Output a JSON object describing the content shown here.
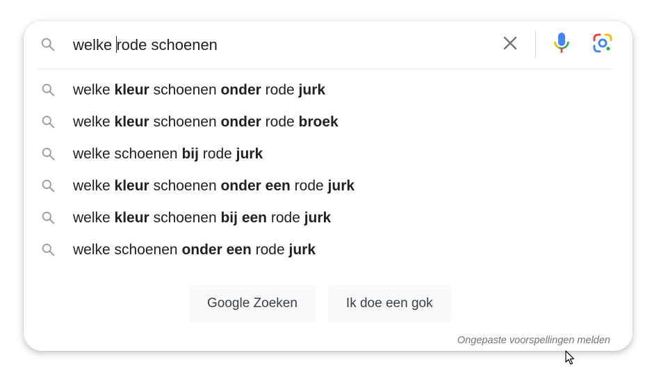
{
  "search": {
    "query_before_caret": "welke ",
    "query_after_caret": "rode schoenen"
  },
  "icons": {
    "search": "search-icon",
    "clear": "close-icon",
    "voice": "microphone-icon",
    "lens": "google-lens-icon",
    "cursor": "mouse-pointer-icon"
  },
  "suggestions": [
    [
      {
        "t": "welke ",
        "b": false
      },
      {
        "t": "kleur",
        "b": true
      },
      {
        "t": " schoenen ",
        "b": false
      },
      {
        "t": "onder",
        "b": true
      },
      {
        "t": " rode ",
        "b": false
      },
      {
        "t": "jurk",
        "b": true
      }
    ],
    [
      {
        "t": "welke ",
        "b": false
      },
      {
        "t": "kleur",
        "b": true
      },
      {
        "t": " schoenen ",
        "b": false
      },
      {
        "t": "onder",
        "b": true
      },
      {
        "t": " rode ",
        "b": false
      },
      {
        "t": "broek",
        "b": true
      }
    ],
    [
      {
        "t": "welke schoenen ",
        "b": false
      },
      {
        "t": "bij",
        "b": true
      },
      {
        "t": " rode ",
        "b": false
      },
      {
        "t": "jurk",
        "b": true
      }
    ],
    [
      {
        "t": "welke ",
        "b": false
      },
      {
        "t": "kleur",
        "b": true
      },
      {
        "t": " schoenen ",
        "b": false
      },
      {
        "t": "onder een",
        "b": true
      },
      {
        "t": " rode ",
        "b": false
      },
      {
        "t": "jurk",
        "b": true
      }
    ],
    [
      {
        "t": "welke ",
        "b": false
      },
      {
        "t": "kleur",
        "b": true
      },
      {
        "t": " schoenen ",
        "b": false
      },
      {
        "t": "bij een",
        "b": true
      },
      {
        "t": " rode ",
        "b": false
      },
      {
        "t": "jurk",
        "b": true
      }
    ],
    [
      {
        "t": "welke schoenen ",
        "b": false
      },
      {
        "t": "onder een",
        "b": true
      },
      {
        "t": " rode ",
        "b": false
      },
      {
        "t": "jurk",
        "b": true
      }
    ]
  ],
  "buttons": {
    "search_label": "Google Zoeken",
    "lucky_label": "Ik doe een gok"
  },
  "footer": {
    "report_label": "Ongepaste voorspellingen melden"
  },
  "colors": {
    "google_blue": "#4285f4",
    "google_red": "#ea4335",
    "google_yellow": "#fbbc04",
    "google_green": "#34a853",
    "icon_gray": "#9aa0a6"
  }
}
